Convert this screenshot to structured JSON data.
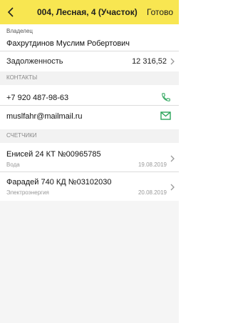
{
  "header": {
    "title": "004, Лесная, 4 (Участок)",
    "done_label": "Готово",
    "bg_color": "#f8e651"
  },
  "owner": {
    "label": "Владелец",
    "name": "Фахрутдинов Муслим Робертович"
  },
  "debt": {
    "label": "Задолженность",
    "value": "12 316,52"
  },
  "contacts": {
    "section_label": "КОНТАКТЫ",
    "phone": "+7 920 487-98-63",
    "email": "muslfahr@mailmail.ru",
    "icon_color": "#2aa55a"
  },
  "meters": {
    "section_label": "СЧЕТЧИКИ",
    "items": [
      {
        "name": "Енисей 24 КТ №00965785",
        "type": "Вода",
        "date": "19.08.2019"
      },
      {
        "name": "Фарадей 740 КД №03102030",
        "type": "Электроэнергия",
        "date": "20.08.2019"
      }
    ]
  }
}
